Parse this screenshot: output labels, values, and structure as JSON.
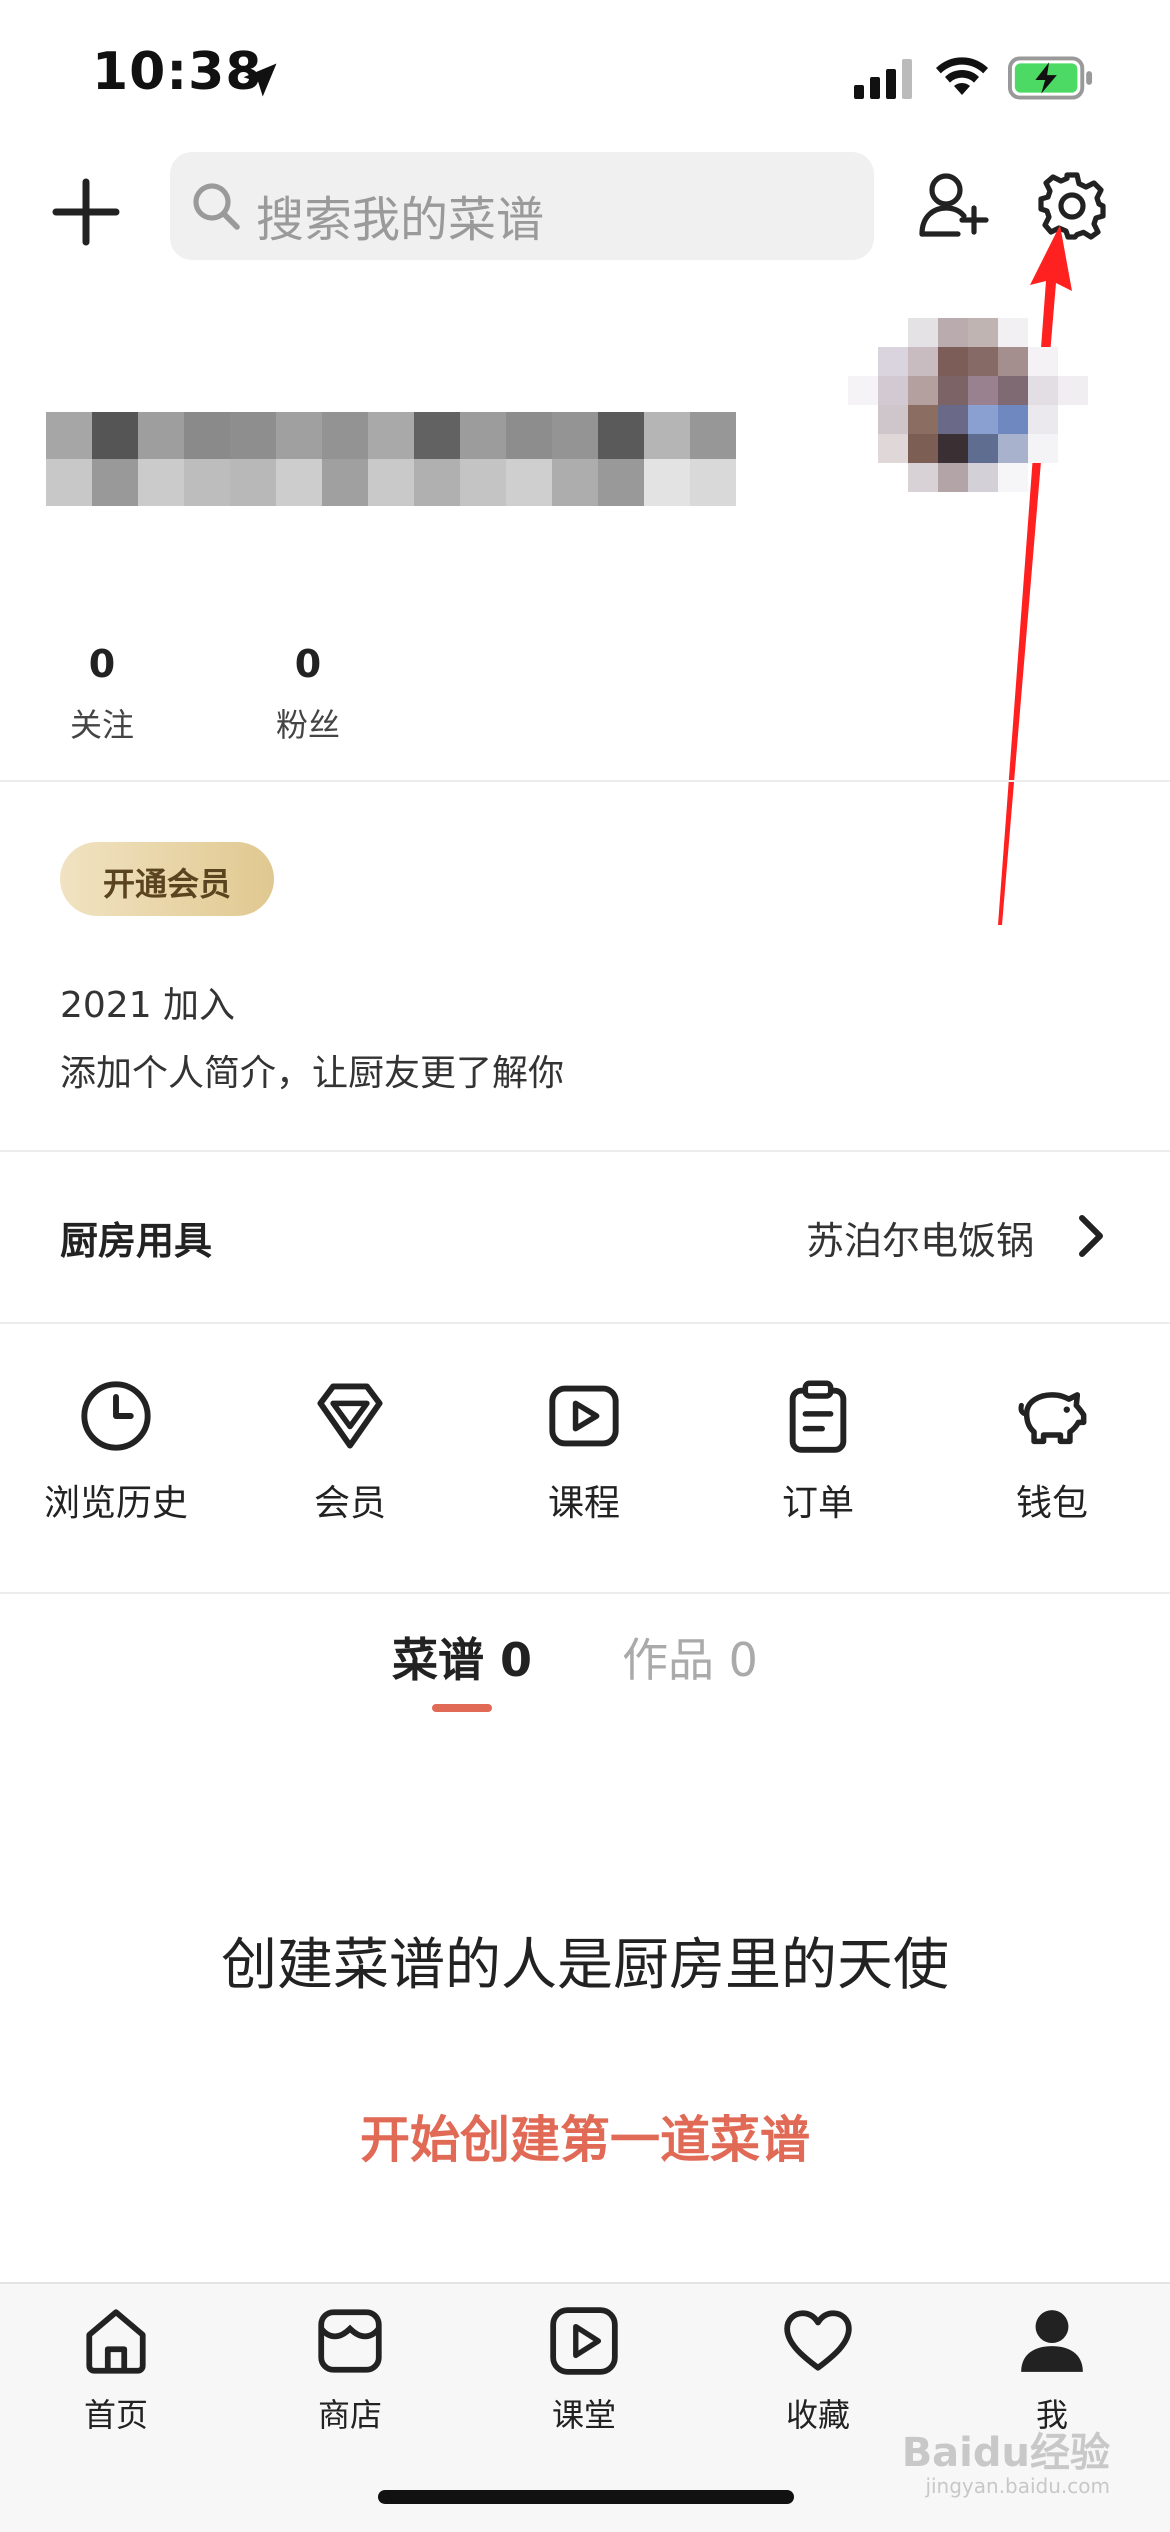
{
  "status_bar": {
    "time": "10:38",
    "icons": [
      "location-arrow-icon",
      "cellular-signal-icon",
      "wifi-icon",
      "battery-charging-icon"
    ]
  },
  "header": {
    "search_placeholder": "搜索我的菜谱",
    "icons": [
      "plus-icon",
      "search-icon",
      "add-user-icon",
      "gear-icon"
    ]
  },
  "profile": {
    "username": "",
    "following_count": "0",
    "following_label": "关注",
    "fans_count": "0",
    "fans_label": "粉丝",
    "vip_label": "开通会员",
    "joined": "2021 加入",
    "bio": "添加个人简介，让厨友更了解你"
  },
  "kitchen": {
    "label": "厨房用具",
    "value": "苏泊尔电饭锅"
  },
  "shortcuts": [
    {
      "label": "浏览历史",
      "icon": "clock-icon"
    },
    {
      "label": "会员",
      "icon": "diamond-icon"
    },
    {
      "label": "课程",
      "icon": "play-icon"
    },
    {
      "label": "订单",
      "icon": "clipboard-icon"
    },
    {
      "label": "钱包",
      "icon": "piggy-bank-icon"
    }
  ],
  "tabs": [
    {
      "label": "菜谱 0",
      "active": true
    },
    {
      "label": "作品 0",
      "active": false
    }
  ],
  "empty_state": {
    "title": "创建菜谱的人是厨房里的天使",
    "action": "开始创建第一道菜谱"
  },
  "bottom_nav": [
    {
      "label": "首页",
      "icon": "home-icon"
    },
    {
      "label": "商店",
      "icon": "store-icon"
    },
    {
      "label": "课堂",
      "icon": "classroom-play-icon"
    },
    {
      "label": "收藏",
      "icon": "heart-icon"
    },
    {
      "label": "我",
      "icon": "user-icon",
      "active": true
    }
  ],
  "watermark": {
    "text": "Baidu经验",
    "sub": "jingyan.baidu.com"
  },
  "colors": {
    "accent": "#e06a55",
    "annotation_arrow": "#ff2020",
    "vip_gold": "#e0c890"
  }
}
